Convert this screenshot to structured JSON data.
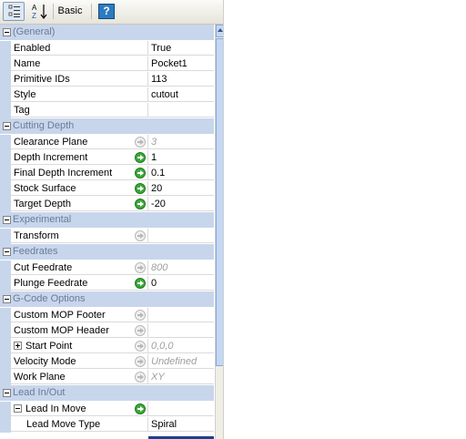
{
  "toolbar": {
    "categorized_icon": "categorized-icon",
    "alphabetical_icon": "sort-alphabetical-icon",
    "alphabetical_text": "A Z",
    "basic_label": "Basic",
    "help_icon": "help-icon",
    "help_text": "?"
  },
  "categories": [
    {
      "label": "(General)"
    },
    {
      "label": "Cutting Depth"
    },
    {
      "label": "Experimental"
    },
    {
      "label": "Feedrates"
    },
    {
      "label": "G-Code Options"
    },
    {
      "label": "Lead In/Out"
    }
  ],
  "general": [
    {
      "name": "Enabled",
      "value": "True"
    },
    {
      "name": "Name",
      "value": "Pocket1"
    },
    {
      "name": "Primitive IDs",
      "value": "113"
    },
    {
      "name": "Style",
      "value": "cutout"
    },
    {
      "name": "Tag",
      "value": ""
    }
  ],
  "cutting_depth": [
    {
      "name": "Clearance Plane",
      "value": "3",
      "arrow": "inactive"
    },
    {
      "name": "Depth Increment",
      "value": "1",
      "arrow": "active"
    },
    {
      "name": "Final Depth Increment",
      "value": "0.1",
      "arrow": "active"
    },
    {
      "name": "Stock Surface",
      "value": "20",
      "arrow": "active"
    },
    {
      "name": "Target Depth",
      "value": "-20",
      "arrow": "active"
    }
  ],
  "experimental": [
    {
      "name": "Transform",
      "value": "",
      "arrow": "inactive"
    }
  ],
  "feedrates": [
    {
      "name": "Cut Feedrate",
      "value": "800",
      "arrow": "inactive"
    },
    {
      "name": "Plunge Feedrate",
      "value": "0",
      "arrow": "active"
    }
  ],
  "gcode": [
    {
      "name": "Custom MOP Footer",
      "value": "",
      "arrow": "inactive"
    },
    {
      "name": "Custom MOP Header",
      "value": "",
      "arrow": "inactive"
    },
    {
      "name": "Start Point",
      "value": "0,0,0",
      "arrow": "inactive"
    },
    {
      "name": "Velocity Mode",
      "value": "Undefined",
      "arrow": "inactive"
    },
    {
      "name": "Work Plane",
      "value": "XY",
      "arrow": "inactive"
    }
  ],
  "lead": [
    {
      "name": "Lead In Move",
      "value": "",
      "arrow": "active"
    },
    {
      "name": "Lead Move Type",
      "value": "Spiral"
    }
  ],
  "colors": {
    "category_bg": "#c8d6ec",
    "category_text": "#6b7a99",
    "active_arrow": "#3da93a",
    "selection": "#1f3f8f"
  }
}
